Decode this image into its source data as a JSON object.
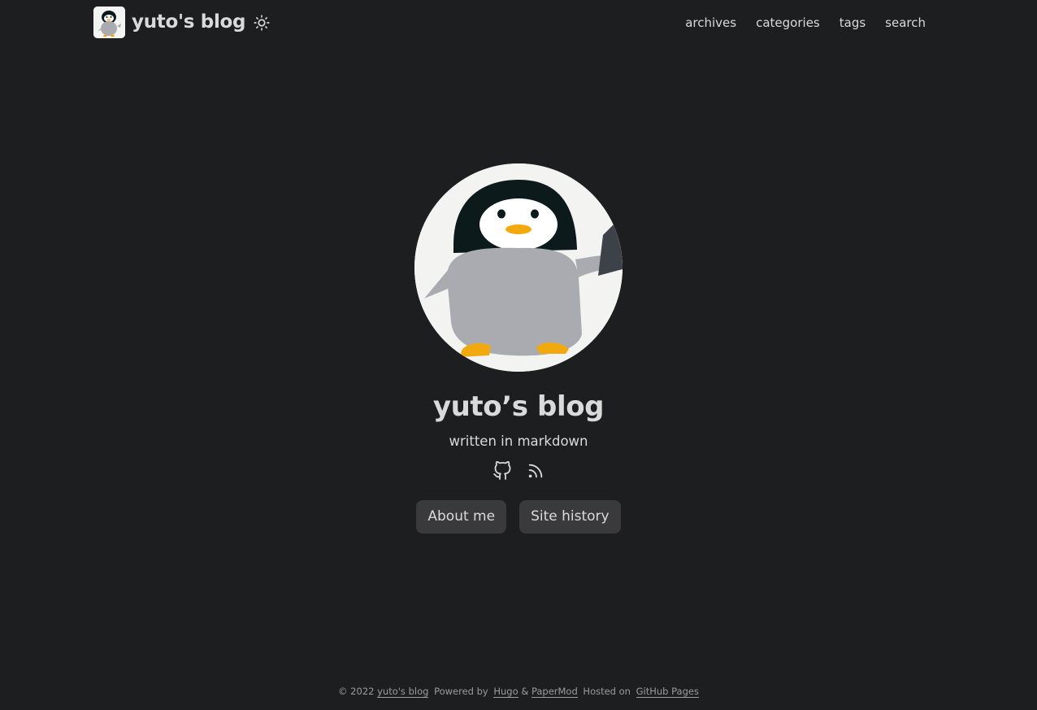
{
  "header": {
    "site_title": "yuto's blog",
    "menu": [
      {
        "label": "archives"
      },
      {
        "label": "categories"
      },
      {
        "label": "tags"
      },
      {
        "label": "search"
      }
    ]
  },
  "profile": {
    "title": "yuto’s blog",
    "subtitle": "written in markdown",
    "social": [
      "github-icon",
      "rss-icon"
    ],
    "buttons": [
      {
        "label": "About me"
      },
      {
        "label": "Site history"
      }
    ]
  },
  "footer": {
    "copyright": "© 2022",
    "site_link": "yuto's blog",
    "powered_by": "Powered by",
    "hugo": "Hugo",
    "amp": "&",
    "papermod": "PaperMod",
    "hosted_on": "Hosted on",
    "github_pages": "GitHub Pages"
  },
  "colors": {
    "background": "#1d1e20",
    "text": "#dadadb",
    "button_bg": "#3a3a3d",
    "footer_text": "#9b9c9d"
  }
}
